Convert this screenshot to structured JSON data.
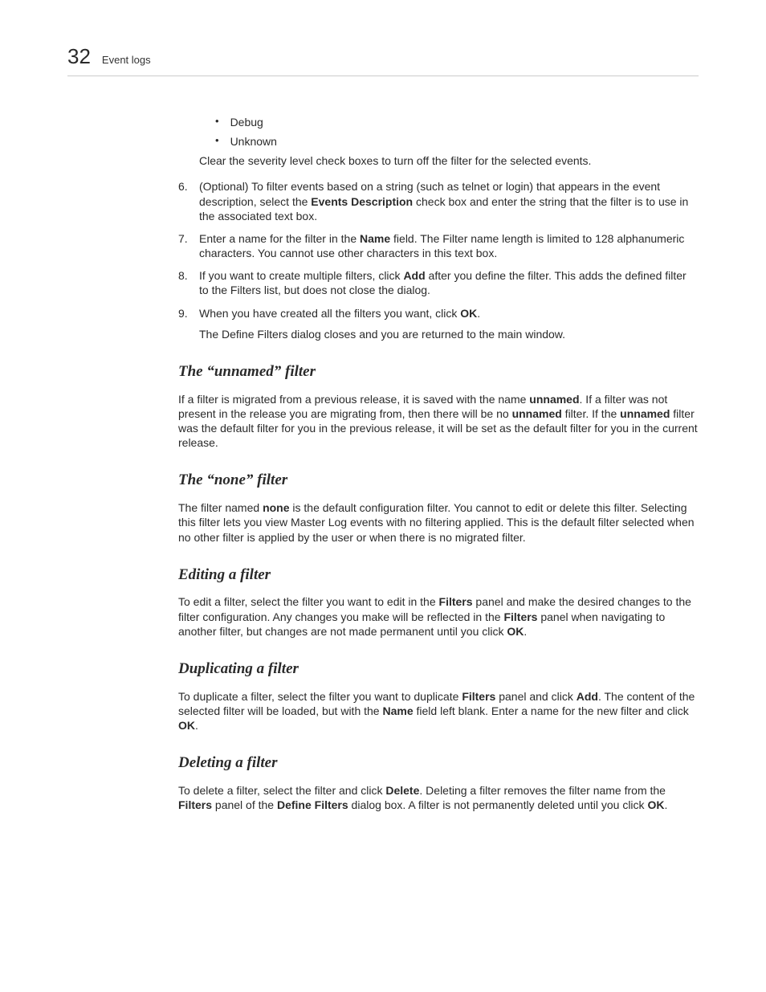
{
  "header": {
    "page_number": "32",
    "section": "Event logs"
  },
  "bullets": {
    "b1": "Debug",
    "b2": "Unknown"
  },
  "after_bullets": "Clear the severity level check boxes to turn off the filter for the selected events.",
  "steps": {
    "s6": {
      "num": "6.",
      "t1": "(Optional) To filter events based on a string (such as telnet or login) that appears in the event description, select the ",
      "b1": "Events Description",
      "t2": " check box and enter the string that the filter is to use in the associated text box."
    },
    "s7": {
      "num": "7.",
      "t1": "Enter a name for the filter in the ",
      "b1": "Name",
      "t2": " field. The Filter name length is limited to 128 alphanumeric characters. You cannot use other characters in this text box."
    },
    "s8": {
      "num": "8.",
      "t1": "If you want to create multiple filters, click ",
      "b1": "Add",
      "t2": " after you define the filter. This adds the defined filter to the Filters list, but does not close the dialog."
    },
    "s9": {
      "num": "9.",
      "t1": "When you have created all the filters you want, click ",
      "b1": "OK",
      "t2": ".",
      "follow": "The Define Filters dialog closes and you are returned to the main window."
    }
  },
  "sections": {
    "unnamed": {
      "h": "The “unnamed” filter",
      "p": {
        "t1": "If a filter is migrated from a previous release, it is saved with the name ",
        "b1": "unnamed",
        "t2": ". If a filter was not present in the release you are migrating from, then there will be no ",
        "b2": "unnamed",
        "t3": " filter. If the ",
        "b3": "unnamed",
        "t4": " filter was the default filter for you in the previous release, it will be set as the default filter for you in the current release."
      }
    },
    "none": {
      "h": "The “none” filter",
      "p": {
        "t1": "The filter named ",
        "b1": "none",
        "t2": " is the default configuration filter. You cannot to edit or delete this filter. Selecting this filter lets you view Master Log events with no filtering applied. This is the default filter selected when no other filter is applied by the user or when there is no migrated filter."
      }
    },
    "editing": {
      "h": "Editing a filter",
      "p": {
        "t1": "To edit a filter, select the filter you want to edit in the ",
        "b1": "Filters",
        "t2": " panel and make the desired changes to the filter configuration. Any changes you make will be reflected in the ",
        "b2": "Filters",
        "t3": " panel when navigating to another filter, but changes are not made permanent until you click ",
        "b3": "OK",
        "t4": "."
      }
    },
    "dup": {
      "h": "Duplicating a filter",
      "p": {
        "t1": "To duplicate a filter, select the filter you want to duplicate ",
        "b1": "Filters",
        "t2": " panel and click ",
        "b2": "Add",
        "t3": ". The content of the selected filter will be loaded, but with the ",
        "b3": "Name",
        "t4": " field left blank. Enter a name for the new filter and click ",
        "b4": "OK",
        "t5": "."
      }
    },
    "del": {
      "h": "Deleting a filter",
      "p": {
        "t1": "To delete a filter, select the filter and click ",
        "b1": "Delete",
        "t2": ". Deleting a filter removes the filter name from the ",
        "b2": "Filters",
        "t3": " panel of the ",
        "b3": "Define Filters",
        "t4": " dialog box. A filter is not permanently deleted until you click ",
        "b4": "OK",
        "t5": "."
      }
    }
  }
}
